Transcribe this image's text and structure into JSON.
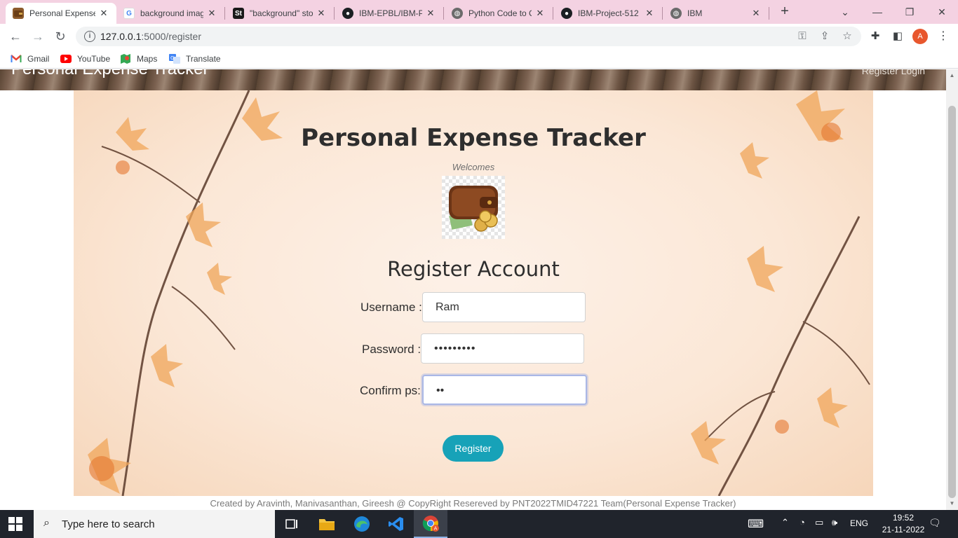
{
  "browser": {
    "tabs": [
      {
        "title": "Personal Expense",
        "favicon": "wallet-icon",
        "active": true
      },
      {
        "title": "background imag",
        "favicon": "google-icon",
        "active": false
      },
      {
        "title": "\"background\" sto",
        "favicon": "stock-icon",
        "active": false
      },
      {
        "title": "IBM-EPBL/IBM-P",
        "favicon": "github-icon",
        "active": false
      },
      {
        "title": "Python Code to C",
        "favicon": "globe-icon",
        "active": false
      },
      {
        "title": "IBM-Project-512",
        "favicon": "github-icon",
        "active": false
      },
      {
        "title": "IBM",
        "favicon": "globe-icon",
        "active": false
      }
    ],
    "new_tab": "+",
    "url_host": "127.0.0.1",
    "url_path": ":5000/register",
    "profile_initial": "A",
    "bookmarks": [
      {
        "label": "Gmail",
        "icon": "gmail-icon"
      },
      {
        "label": "YouTube",
        "icon": "youtube-icon"
      },
      {
        "label": "Maps",
        "icon": "maps-icon"
      },
      {
        "label": "Translate",
        "icon": "translate-icon"
      }
    ]
  },
  "page": {
    "banner_title": "Personal Expense Tracker",
    "banner_links": "Register  Login",
    "app_title": "Personal Expense Tracker",
    "welcome": "Welcomes",
    "register_heading": "Register Account",
    "form": {
      "username_label": "Username :",
      "username_value": "Ram",
      "password_label": "Password :",
      "password_value": "•••••••••",
      "confirm_label": "Confirm ps:",
      "confirm_value": "••"
    },
    "register_button": "Register",
    "footer": "Created by Aravinth, Manivasanthan, Gireesh @ CopyRight Resereved by PNT2022TMID47221 Team(Personal Expense Tracker)"
  },
  "taskbar": {
    "search_placeholder": "Type here to search",
    "language": "ENG",
    "time": "19:52",
    "date": "21-11-2022"
  },
  "colors": {
    "accent_button": "#17a2b8",
    "tab_strip": "#f4d2e2"
  }
}
